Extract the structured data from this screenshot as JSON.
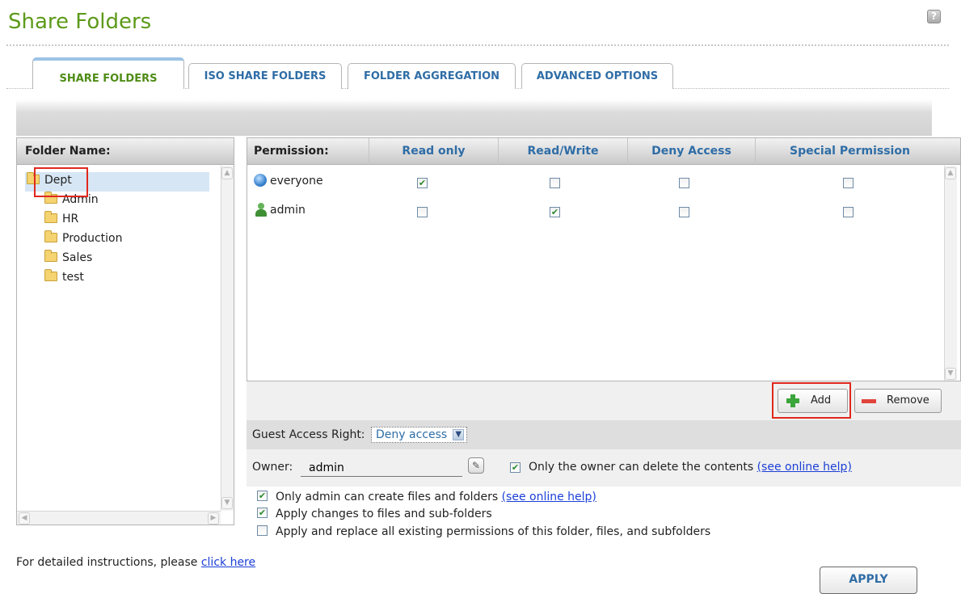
{
  "page": {
    "title": "Share Folders",
    "help_icon": "?"
  },
  "tabs": [
    {
      "label": "SHARE FOLDERS",
      "active": true
    },
    {
      "label": "ISO SHARE FOLDERS",
      "active": false
    },
    {
      "label": "FOLDER AGGREGATION",
      "active": false
    },
    {
      "label": "ADVANCED OPTIONS",
      "active": false
    }
  ],
  "folder_panel": {
    "header": "Folder Name:",
    "root": "Dept",
    "children": [
      "Admin",
      "HR",
      "Production",
      "Sales",
      "test"
    ]
  },
  "permission_table": {
    "headers": {
      "permission": "Permission:",
      "read_only": "Read only",
      "read_write": "Read/Write",
      "deny_access": "Deny Access",
      "special": "Special Permission"
    },
    "rows": [
      {
        "name": "everyone",
        "icon": "group-icon",
        "read_only": true,
        "read_write": false,
        "deny_access": false,
        "special": false
      },
      {
        "name": "admin",
        "icon": "user-icon",
        "read_only": false,
        "read_write": true,
        "deny_access": false,
        "special": false
      }
    ]
  },
  "actions": {
    "add_label": "Add",
    "remove_label": "Remove"
  },
  "guest": {
    "label": "Guest Access Right:",
    "value": "Deny access"
  },
  "owner": {
    "label": "Owner:",
    "value": "admin",
    "delete_option_label": "Only the owner can delete the contents",
    "delete_option_checked": true,
    "help_link": "(see online help)"
  },
  "options": {
    "admin_create": {
      "label": "Only admin can create files and folders",
      "checked": true,
      "link": "(see online help)"
    },
    "apply_changes": {
      "label": "Apply changes to files and sub-folders",
      "checked": true
    },
    "apply_replace": {
      "label": "Apply and replace all existing permissions of this folder, files, and subfolders",
      "checked": false
    }
  },
  "footer": {
    "instructions": "For detailed instructions, please",
    "link": "click here",
    "apply_label": "APPLY"
  },
  "colors": {
    "title_green": "#5d9a1a",
    "tab_blue": "#2f6da6",
    "link_blue": "#1b3fd6",
    "highlight_red": "#e0281e"
  }
}
